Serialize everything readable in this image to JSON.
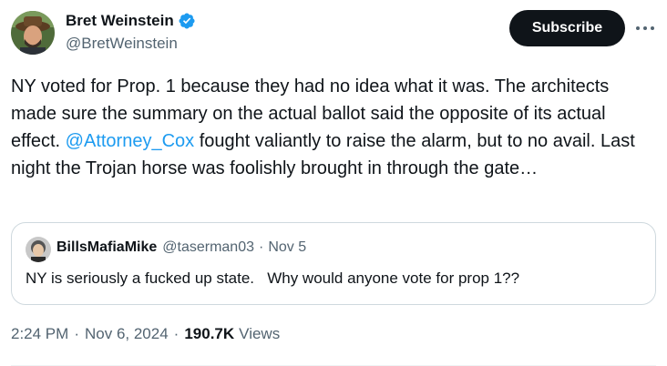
{
  "author": {
    "name": "Bret Weinstein",
    "handle": "@BretWeinstein",
    "verified": true,
    "verified_color": "#1d9bf0"
  },
  "actions": {
    "subscribe_label": "Subscribe",
    "more_icon": "more-horizontal-icon"
  },
  "tweet": {
    "text_parts": [
      "NY voted for Prop. 1 because they had no idea what it was. The architects made sure the summary on the actual ballot said the opposite of its actual effect. ",
      "@Attorney_Cox",
      " fought valiantly to raise the alarm, but to no avail. Last night the Trojan horse was foolishly brought in through the gate…"
    ],
    "mention_color": "#1d9bf0"
  },
  "quote": {
    "name": "BillsMafiaMike",
    "handle": "@taserman03",
    "dot": "·",
    "date": "Nov 5",
    "text": "NY is seriously a fucked up state.   Why would anyone vote for prop 1??"
  },
  "meta": {
    "time": "2:24 PM",
    "sep1": "·",
    "date": "Nov 6, 2024",
    "sep2": "·",
    "views_count": "190.7K",
    "views_label": "Views"
  }
}
